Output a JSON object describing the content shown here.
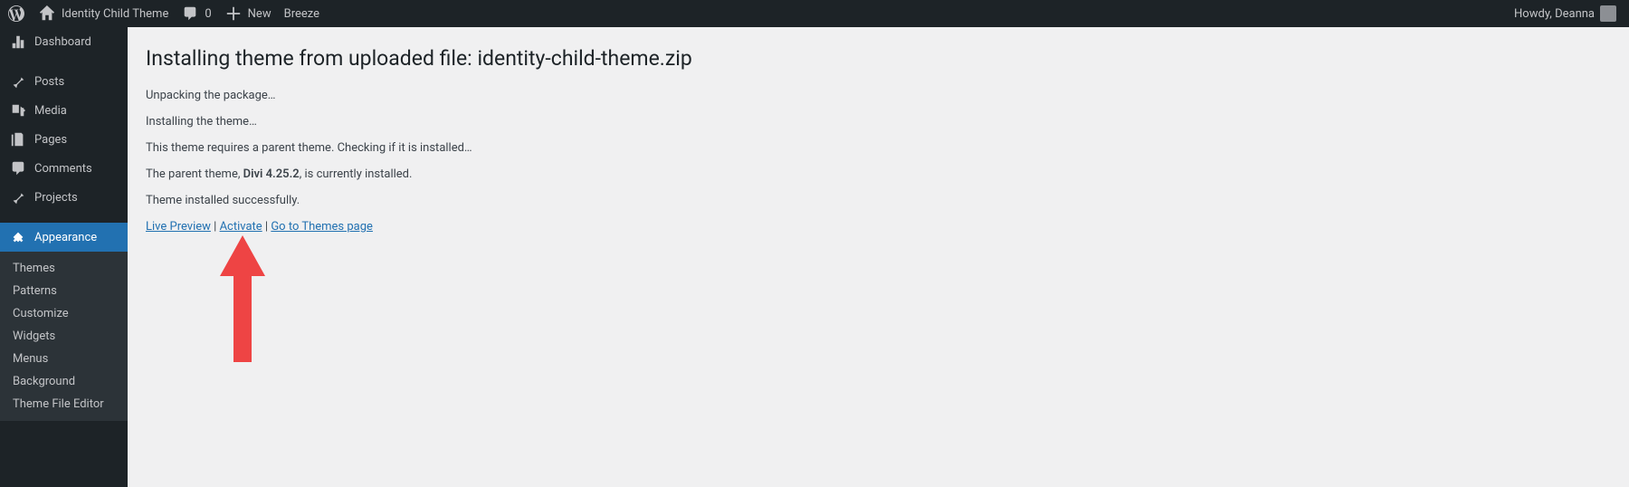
{
  "admin_bar": {
    "site_name": "Identity Child Theme",
    "comments_count": "0",
    "new_label": "New",
    "breeze_label": "Breeze",
    "howdy": "Howdy, Deanna"
  },
  "menu": {
    "dashboard": "Dashboard",
    "posts": "Posts",
    "media": "Media",
    "pages": "Pages",
    "comments": "Comments",
    "projects": "Projects",
    "appearance": "Appearance",
    "submenu": {
      "themes": "Themes",
      "patterns": "Patterns",
      "customize": "Customize",
      "widgets": "Widgets",
      "menus": "Menus",
      "background": "Background",
      "theme_file_editor": "Theme File Editor"
    }
  },
  "page": {
    "heading": "Installing theme from uploaded file: identity-child-theme.zip",
    "lines": {
      "unpacking": "Unpacking the package…",
      "installing": "Installing the theme…",
      "checking": "This theme requires a parent theme. Checking if it is installed…",
      "parent_prefix": "The parent theme, ",
      "parent_name": "Divi 4.25.2",
      "parent_suffix": ", is currently installed.",
      "success": "Theme installed successfully."
    },
    "actions": {
      "live_preview": "Live Preview",
      "activate": "Activate",
      "go_to_themes": "Go to Themes page"
    }
  }
}
